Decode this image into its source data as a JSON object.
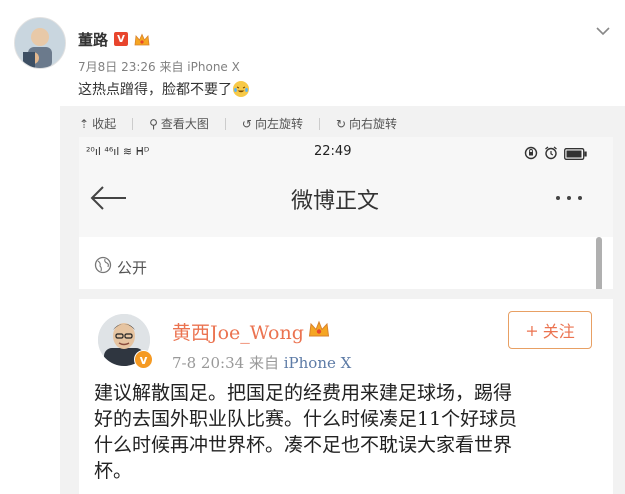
{
  "post": {
    "author": "董路",
    "vip_badge": "V",
    "meta": "7月8日 23:26 来自 iPhone X",
    "text": "这热点蹭得，脸都不要了",
    "emoji_icon": "laugh-cry-emoji"
  },
  "viewer_tools": [
    {
      "icon": "collapse-icon",
      "glyph": "⇡",
      "label": "收起"
    },
    {
      "icon": "search-icon",
      "glyph": "⚲",
      "label": "查看大图"
    },
    {
      "icon": "rotate-left-icon",
      "glyph": "↺",
      "label": "向左旋转"
    },
    {
      "icon": "rotate-right-icon",
      "glyph": "↻",
      "label": "向右旋转"
    }
  ],
  "screenshot": {
    "status_left": "²⁰ıl ⁴⁶ıl ≋ ᕼᴰ",
    "status_time": "22:49",
    "nav_title": "微博正文",
    "visibility": "公开",
    "author": "黄西Joe_Wong",
    "verified_badge": "v",
    "meta_time": "7-8 20:34",
    "meta_from": "来自",
    "meta_source": "iPhone X",
    "follow_label": "关注",
    "follow_plus": "+",
    "body_lines": [
      "建议解散国足。把国足的经费用来建足球场，踢得",
      "好的去国外职业队比赛。什么时候凑足11个好球员",
      "什么时候再冲世界杯。凑不足也不耽误大家看世界",
      "杯。"
    ]
  },
  "colors": {
    "accent_orange": "#eb7350",
    "link_blue": "#5d7ba6",
    "vip_red": "#e8452d",
    "verified_orange": "#f59a23"
  }
}
